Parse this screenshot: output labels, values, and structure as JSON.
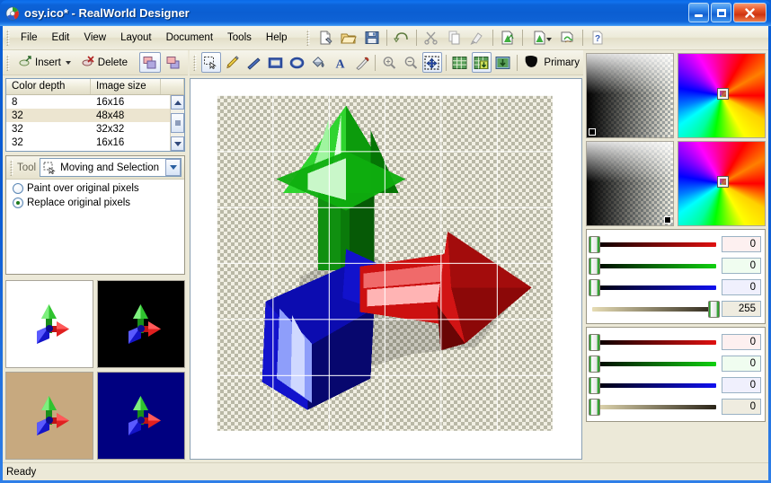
{
  "window": {
    "title": "osy.ico* - RealWorld Designer",
    "app_icon": "realworld-logo-icon",
    "buttons": {
      "minimize": "minimize-icon",
      "maximize": "maximize-icon",
      "close": "close-icon"
    }
  },
  "menu": {
    "items": [
      "File",
      "Edit",
      "View",
      "Layout",
      "Document",
      "Tools",
      "Help"
    ]
  },
  "main_toolbar": {
    "groups": [
      [
        "new-document-icon",
        "open-folder-icon",
        "save-disk-icon"
      ],
      [
        "undo-arrow-icon"
      ],
      [
        "cut-scissors-icon",
        "copy-pages-icon",
        "paste-brush-icon"
      ],
      [
        "import-image-icon"
      ],
      [
        "export-image-icon",
        "export-dropdown-caret-icon"
      ],
      [
        "apply-hand-icon"
      ],
      [
        "help-question-icon"
      ]
    ]
  },
  "layer_toolbar": {
    "insert_label": "Insert",
    "insert_icon": "insert-layer-icon",
    "insert_caret": "chevron-down-icon",
    "delete_label": "Delete",
    "delete_icon": "delete-layer-icon",
    "arrange_buttons": [
      "layers-front-icon",
      "layers-back-icon"
    ],
    "arrange_active_index": 0
  },
  "image_list": {
    "headers": [
      "Color depth",
      "Image size",
      ""
    ],
    "rows": [
      {
        "depth": "8",
        "size": "16x16"
      },
      {
        "depth": "32",
        "size": "48x48"
      },
      {
        "depth": "32",
        "size": "32x32"
      },
      {
        "depth": "32",
        "size": "16x16"
      }
    ],
    "selected_index": 1,
    "scrollbar": {
      "up_icon": "scroll-up-icon",
      "down_icon": "scroll-down-icon",
      "thumb_icon": "scroll-thumb-grip-icon"
    }
  },
  "tool_panel": {
    "label": "Tool",
    "selected_tool": "Moving and Selection",
    "tool_icon": "selection-arrow-icon",
    "dropdown_icon": "chevron-down-icon",
    "options": [
      {
        "label": "Paint over original pixels",
        "selected": false
      },
      {
        "label": "Replace original pixels",
        "selected": true
      }
    ]
  },
  "previews": [
    {
      "name": "preview-white",
      "background": "#ffffff"
    },
    {
      "name": "preview-black",
      "background": "#000000"
    },
    {
      "name": "preview-tan",
      "background": "#c7a97f"
    },
    {
      "name": "preview-blue",
      "background": "#000080"
    }
  ],
  "canvas_toolbar": {
    "draw_tools": [
      {
        "icon": "selection-rectangle-icon",
        "active": true
      },
      {
        "icon": "pencil-icon",
        "active": false
      },
      {
        "icon": "line-icon",
        "active": false
      },
      {
        "icon": "rectangle-icon",
        "active": false
      },
      {
        "icon": "ellipse-icon",
        "active": false
      },
      {
        "icon": "paint-bucket-icon",
        "active": false
      },
      {
        "icon": "text-tool-icon",
        "active": false
      },
      {
        "icon": "eraser-icon",
        "active": false
      }
    ],
    "zoom_tools": [
      {
        "icon": "zoom-in-icon",
        "active": false
      },
      {
        "icon": "zoom-out-icon",
        "active": false
      }
    ],
    "move_tool": {
      "icon": "move-selection-icon",
      "active": true
    },
    "view_modes": [
      {
        "icon": "grid-view-icon",
        "active": false
      },
      {
        "icon": "grid-layer-down-icon",
        "active": true
      },
      {
        "icon": "layer-down-icon",
        "active": false
      }
    ],
    "color_role": {
      "icon": "primary-color-blob-icon",
      "label": "Primary"
    }
  },
  "canvas": {
    "zoom_grid": true,
    "checker_background": true,
    "artwork": "rgb-3d-axis-arrows"
  },
  "color_panels": [
    {
      "name": "primary",
      "alpha_swatch_icon": "alpha-gradient-swatch",
      "alpha_marker_position": "bottom-left",
      "wheel_icon": "hue-saturation-wheel",
      "wheel_cursor_position": "center"
    },
    {
      "name": "secondary",
      "alpha_swatch_icon": "alpha-gradient-swatch",
      "alpha_marker_position": "bottom-right",
      "wheel_icon": "hue-saturation-wheel",
      "wheel_cursor_position": "center"
    }
  ],
  "sliders": [
    {
      "name": "primary-channels",
      "channels": [
        {
          "name": "red",
          "value": "0",
          "track_color": "#e01010",
          "field_bg": "#fdf0f0",
          "thumb_pct": 0
        },
        {
          "name": "green",
          "value": "0",
          "track_color": "#10d010",
          "field_bg": "#f0fdf0",
          "thumb_pct": 0
        },
        {
          "name": "blue",
          "value": "0",
          "track_color": "#1010f0",
          "field_bg": "#f0f0fd",
          "thumb_pct": 0
        },
        {
          "name": "alpha",
          "value": "255",
          "track_color": "#d8cfa8",
          "field_bg": "#efece0",
          "thumb_pct": 100
        }
      ]
    },
    {
      "name": "secondary-channels",
      "channels": [
        {
          "name": "red",
          "value": "0",
          "track_color": "#e01010",
          "field_bg": "#fdf0f0",
          "thumb_pct": 0
        },
        {
          "name": "green",
          "value": "0",
          "track_color": "#10d010",
          "field_bg": "#f0fdf0",
          "thumb_pct": 0
        },
        {
          "name": "blue",
          "value": "0",
          "track_color": "#1010f0",
          "field_bg": "#f0f0fd",
          "thumb_pct": 0
        },
        {
          "name": "alpha",
          "value": "0",
          "track_color": "#d8cfa8",
          "field_bg": "#efece0",
          "thumb_pct": 0
        }
      ]
    }
  ],
  "status_bar": {
    "text": "Ready"
  }
}
